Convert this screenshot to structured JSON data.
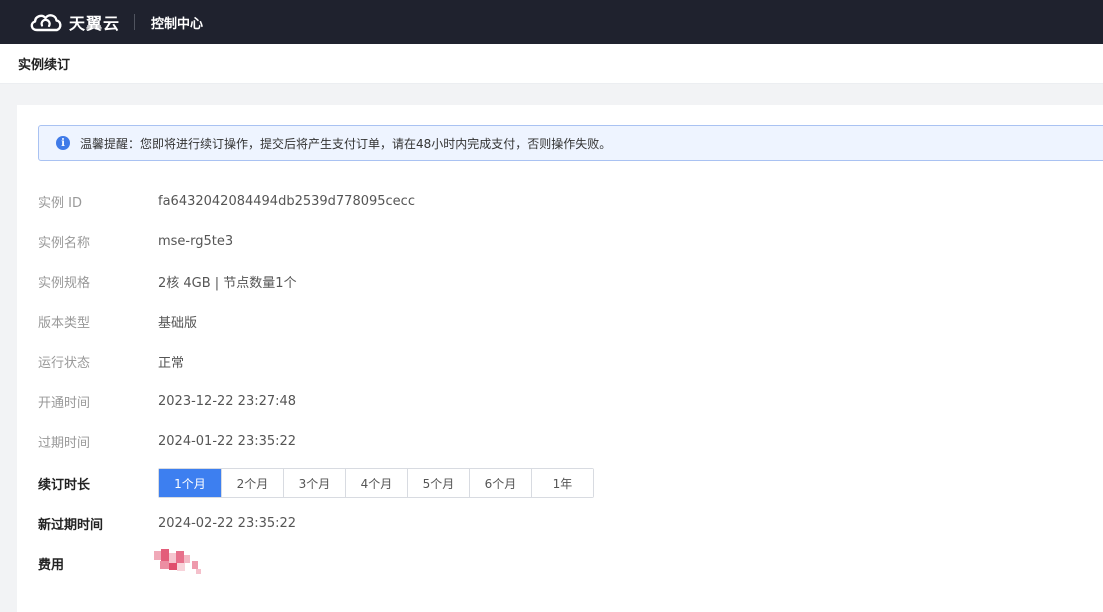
{
  "topbar": {
    "brand_name": "天翼云",
    "console_label": "控制中心"
  },
  "page": {
    "title": "实例续订"
  },
  "notice": {
    "icon": "info-icon",
    "text": "温馨提醒：您即将进行续订操作，提交后将产生支付订单，请在48小时内完成支付，否则操作失败。"
  },
  "details": {
    "instance_id": {
      "label": "实例 ID",
      "value": "fa6432042084494db2539d778095cecc"
    },
    "instance_name": {
      "label": "实例名称",
      "value": "mse-rg5te3"
    },
    "instance_spec": {
      "label": "实例规格",
      "value": "2核 4GB | 节点数量1个"
    },
    "edition": {
      "label": "版本类型",
      "value": "基础版"
    },
    "status": {
      "label": "运行状态",
      "value": "正常"
    },
    "open_time": {
      "label": "开通时间",
      "value": "2023-12-22 23:27:48"
    },
    "expire_time": {
      "label": "过期时间",
      "value": "2024-01-22 23:35:22"
    }
  },
  "renewal": {
    "label": "续订时长",
    "options": [
      "1个月",
      "2个月",
      "3个月",
      "4个月",
      "5个月",
      "6个月",
      "1年"
    ],
    "selected": "1个月"
  },
  "new_expire": {
    "label": "新过期时间",
    "value": "2024-02-22 23:35:22"
  },
  "fee": {
    "label": "费用"
  },
  "colors": {
    "accent": "#3d7ff0",
    "topbar": "#1f222e",
    "notice_bg": "#eef4ff"
  }
}
